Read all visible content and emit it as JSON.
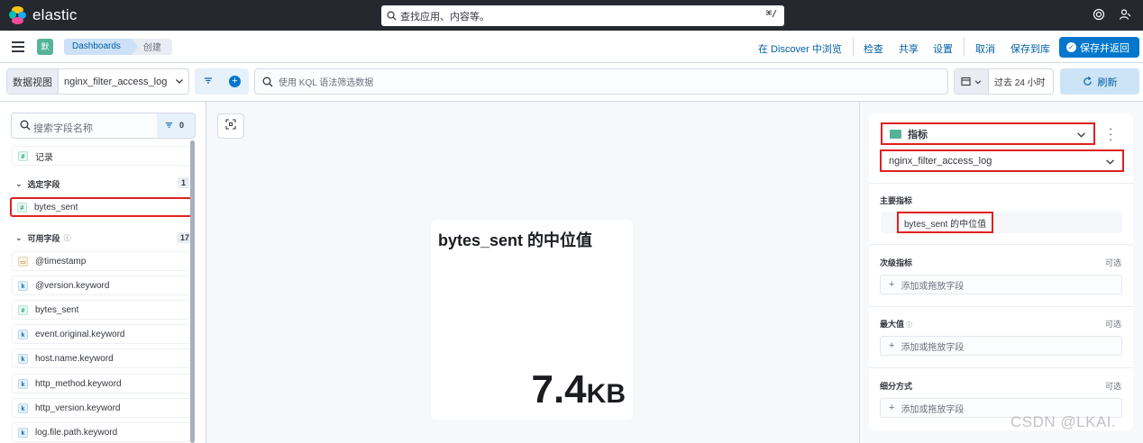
{
  "topbar": {
    "brand": "elastic",
    "search_placeholder": "查找应用、内容等。",
    "shortcut": "⌘/",
    "help_icon": "help-icon",
    "user_icon": "user-menu-icon"
  },
  "header": {
    "app_badge": "默",
    "breadcrumbs": [
      "Dashboards",
      "创建"
    ],
    "links": {
      "discover": "在 Discover 中浏览",
      "inspect": "检查",
      "share": "共享",
      "settings": "设置",
      "cancel": "取消",
      "save_to_library": "保存到库"
    },
    "save_and_return": "保存并返回"
  },
  "query": {
    "data_view_label": "数据视图",
    "data_view_value": "nginx_filter_access_log",
    "kql_placeholder": "使用 KQL 语法筛选数据",
    "time_range": "过去 24 小时",
    "refresh": "刷新"
  },
  "fields": {
    "search_placeholder": "搜索字段名称",
    "filter_count": "0",
    "records": "记录",
    "selected_header": "选定字段",
    "selected_count": "1",
    "selected": [
      {
        "name": "bytes_sent",
        "type": "number"
      }
    ],
    "available_header": "可用字段",
    "available_count": "17",
    "available": [
      {
        "name": "@timestamp",
        "type": "date"
      },
      {
        "name": "@version.keyword",
        "type": "keyword"
      },
      {
        "name": "bytes_sent",
        "type": "number"
      },
      {
        "name": "event.original.keyword",
        "type": "keyword"
      },
      {
        "name": "host.name.keyword",
        "type": "keyword"
      },
      {
        "name": "http_method.keyword",
        "type": "keyword"
      },
      {
        "name": "http_version.keyword",
        "type": "keyword"
      },
      {
        "name": "log.file.path.keyword",
        "type": "keyword"
      }
    ]
  },
  "metric": {
    "title": "bytes_sent 的中位值",
    "value": "7.4",
    "unit": "KB"
  },
  "config": {
    "vis_type": "指标",
    "data_view": "nginx_filter_access_log",
    "primary_label": "主要指标",
    "primary_value": "bytes_sent 的中位值",
    "secondary_label": "次级指标",
    "max_label": "最大值",
    "breakdown_label": "细分方式",
    "optional": "可选",
    "add_field": "添加或拖放字段"
  },
  "watermark": "CSDN @LKAI.",
  "colors": {
    "accent": "#0077cc",
    "highlight_box": "#e02020",
    "topbar": "#25282f"
  }
}
